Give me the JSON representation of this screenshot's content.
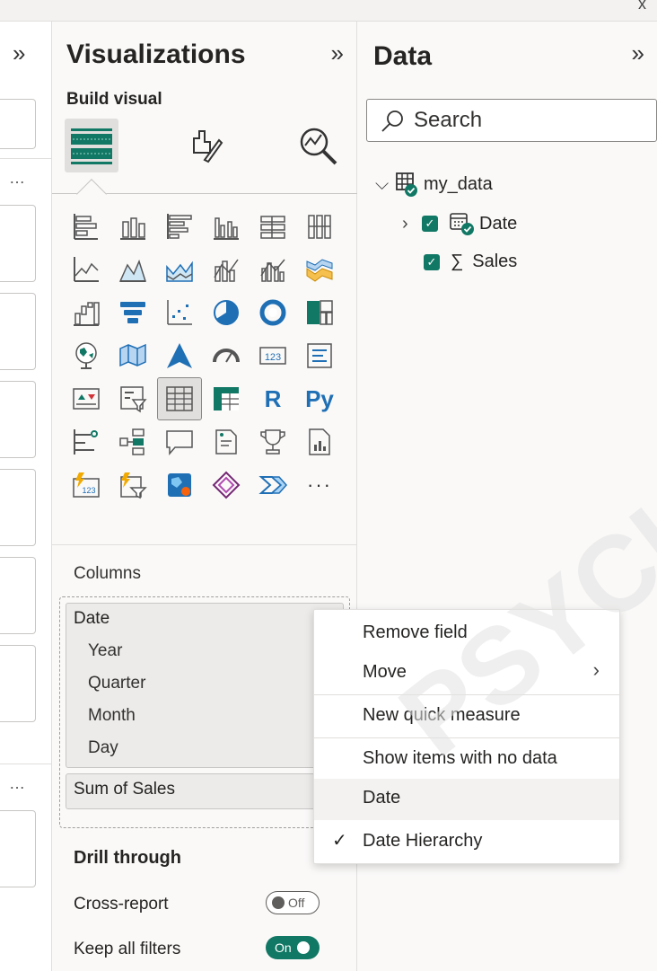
{
  "window": {
    "close_glyph": "x"
  },
  "filters_pane": {
    "expand_glyph": "»",
    "more_glyph": "…"
  },
  "visualizations": {
    "title": "Visualizations",
    "collapse_glyph": "»",
    "subtitle": "Build visual",
    "tabs": [
      {
        "name": "build-visual",
        "icon": "fields-icon",
        "active": true
      },
      {
        "name": "format-visual",
        "icon": "paintbrush-icon",
        "active": false
      },
      {
        "name": "analytics",
        "icon": "magnifier-chart-icon",
        "active": false
      }
    ],
    "icon_rows": [
      [
        "stacked-bar-chart-icon",
        "stacked-column-chart-icon",
        "clustered-bar-chart-icon",
        "clustered-column-chart-icon",
        "100-stacked-bar-chart-icon",
        "100-stacked-column-chart-icon"
      ],
      [
        "line-chart-icon",
        "area-chart-icon",
        "stacked-area-chart-icon",
        "line-stacked-column-icon",
        "line-clustered-column-icon",
        "ribbon-chart-icon"
      ],
      [
        "waterfall-chart-icon",
        "funnel-chart-icon",
        "scatter-chart-icon",
        "pie-chart-icon",
        "donut-chart-icon",
        "treemap-icon"
      ],
      [
        "map-icon",
        "filled-map-icon",
        "azure-map-icon",
        "gauge-icon",
        "card-icon",
        "multi-row-card-icon"
      ],
      [
        "kpi-icon",
        "slicer-icon",
        "table-icon",
        "matrix-icon",
        "r-visual-icon",
        "python-visual-icon"
      ],
      [
        "key-influencers-icon",
        "decomposition-tree-icon",
        "qa-icon",
        "smart-narrative-icon",
        "metrics-icon",
        "paginated-report-icon"
      ],
      [
        "power-apps-card-icon",
        "power-apps-slicer-icon",
        "arcgis-map-icon",
        "power-apps-icon",
        "power-automate-icon",
        "more-visuals-icon"
      ]
    ],
    "selected_icon": "table-icon",
    "r_label": "R",
    "py_label": "Py",
    "more_label": "···",
    "card_label": "123",
    "columns_label": "Columns",
    "fields": [
      {
        "name": "Date",
        "chevron": "⌵",
        "hierarchy": [
          "Year",
          "Quarter",
          "Month",
          "Day"
        ]
      },
      {
        "name": "Sum of Sales",
        "chevron": "⌵"
      }
    ],
    "drill_through": {
      "title": "Drill through",
      "cross_report": {
        "label": "Cross-report",
        "state": "Off"
      },
      "keep_filters": {
        "label": "Keep all filters",
        "state": "On"
      }
    }
  },
  "data_pane": {
    "title": "Data",
    "collapse_glyph": "»",
    "search_placeholder": "Search",
    "tree": {
      "table": {
        "name": "my_data",
        "chevron": "⌵"
      },
      "items": [
        {
          "name": "Date",
          "chevron": "›",
          "checked": true,
          "check_glyph": "✓",
          "icon": "calendar-hierarchy-icon"
        },
        {
          "name": "Sales",
          "checked": true,
          "check_glyph": "✓",
          "icon": "sigma-icon",
          "icon_glyph": "∑"
        }
      ]
    }
  },
  "context_menu": {
    "items": [
      {
        "label": "Remove field"
      },
      {
        "label": "Move",
        "submenu_glyph": "›"
      },
      {
        "label": "New quick measure"
      },
      {
        "label": "Show items with no data"
      },
      {
        "label": "Date"
      },
      {
        "label": "Date Hierarchy",
        "checked": true,
        "check_glyph": "✓"
      }
    ]
  },
  "watermark_text": "PSYCHO",
  "colors": {
    "accent": "#117865",
    "pane_bg": "#faf9f8",
    "blue": "#1f6fb5"
  }
}
